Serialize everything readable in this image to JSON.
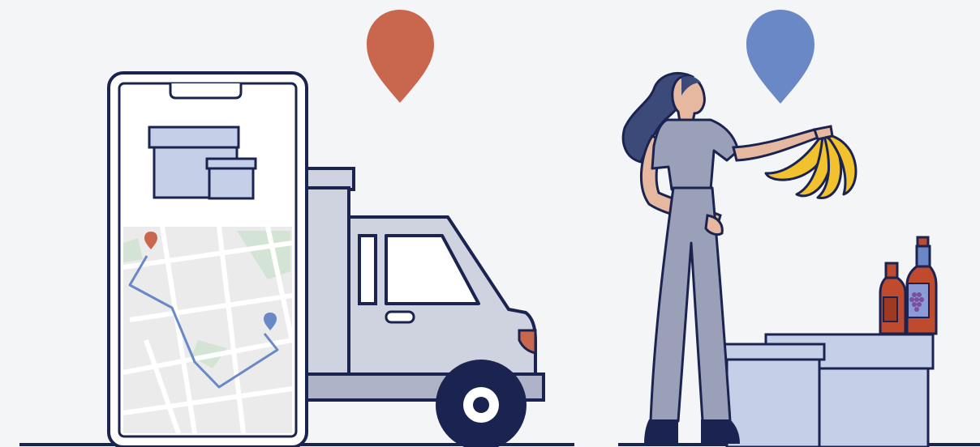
{
  "illustration": {
    "left_panel": {
      "subject": "phone-with-map-and-delivery-truck",
      "pin_icon": "map-pin-icon"
    },
    "right_panel": {
      "subject": "shopper-with-bananas-and-boxes",
      "pin_icon": "map-pin-icon"
    }
  },
  "colors": {
    "background": "#f4f5f7",
    "outline": "#1b2450",
    "pin_orange": "#c8674e",
    "pin_blue": "#6a88c6",
    "box_fill": "#c5d0e8",
    "truck_body": "#cfd3df",
    "map_background": "#ebebeb",
    "map_park": "#d3e4d4",
    "route": "#6a88c6",
    "banana": "#f2c12e",
    "wine_red": "#c04a2e",
    "grape_label": "#8a9bd6",
    "grape": "#7a4ea0",
    "clothing": "#9aa0b8",
    "hair": "#3c4a7a",
    "skin": "#e6b8a0",
    "shoes": "#1b2450"
  }
}
